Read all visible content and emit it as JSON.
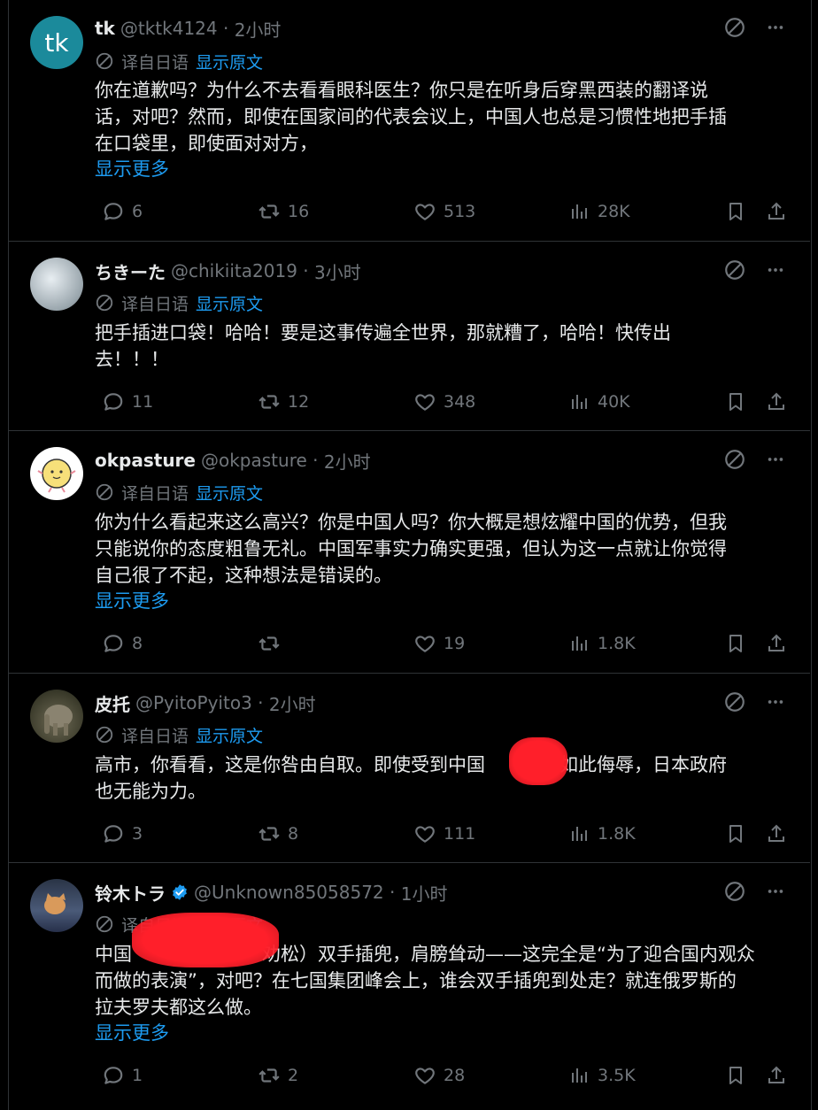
{
  "translation": {
    "translated_from": "译自日语",
    "show_original": "显示原文"
  },
  "show_more": "显示更多",
  "tweets": [
    {
      "name": "tk",
      "handle": "@tktk4124",
      "time": "2小时",
      "avatar_text": "tk",
      "text": "你在道歉吗？为什么不去看看眼科医生？你只是在听身后穿黑西装的翻译说\n话，对吧？然而，即使在国家间的代表会议上，中国人也总是习惯性地把手插\n在口袋里，即使面对对方，",
      "show_more": true,
      "replies": "6",
      "reposts": "16",
      "likes": "513",
      "views": "28K"
    },
    {
      "name": "ちきーた",
      "handle": "@chikiita2019",
      "time": "3小时",
      "text": "把手插进口袋！哈哈！要是这事传遍全世界，那就糟了，哈哈！快传出\n去！！！",
      "show_more": false,
      "replies": "11",
      "reposts": "12",
      "likes": "348",
      "views": "40K"
    },
    {
      "name": "okpasture",
      "handle": "@okpasture",
      "time": "2小时",
      "text": "你为什么看起来这么高兴？你是中国人吗？你大概是想炫耀中国的优势，但我\n只能说你的态度粗鲁无礼。中国军事实力确实更强，但认为这一点就让你觉得\n自己很了不起，这种想法是错误的。",
      "show_more": true,
      "replies": "8",
      "reposts": "",
      "likes": "19",
      "views": "1.8K"
    },
    {
      "name": "皮托",
      "handle": "@PyitoPyito3",
      "time": "2小时",
      "text": "高市，你看看，这是你咎由自取。即使受到中国　　官员如此侮辱，日本政府\n也无能为力。",
      "show_more": false,
      "replies": "3",
      "reposts": "8",
      "likes": "111",
      "views": "1.8K"
    },
    {
      "name": "铃木トラ",
      "handle": "@Unknown85058572",
      "time": "1小时",
      "text": "中国　　　　　　　劝松）双手插兜，肩膀耸动——这完全是“为了迎合国内观众\n而做的表演”，对吧？在七国集团峰会上，谁会双手插兜到处走？就连俄罗斯的\n拉夫罗夫都这么做。",
      "show_more": true,
      "replies": "1",
      "reposts": "2",
      "likes": "28",
      "views": "3.5K"
    }
  ],
  "colors": {
    "background": "#000000",
    "text": "#e7e9ea",
    "muted": "#71767b",
    "link": "#1d9bf0",
    "divider": "#2f3336",
    "verified": "#1d9bf0",
    "redaction": "#ff1f2a"
  },
  "icons": {
    "translate": "translate-icon",
    "more": "more-icon",
    "reply": "reply-icon",
    "repost": "repost-icon",
    "like": "like-icon",
    "views": "views-icon",
    "bookmark": "bookmark-icon",
    "share": "share-icon",
    "verified": "verified-badge-icon"
  }
}
